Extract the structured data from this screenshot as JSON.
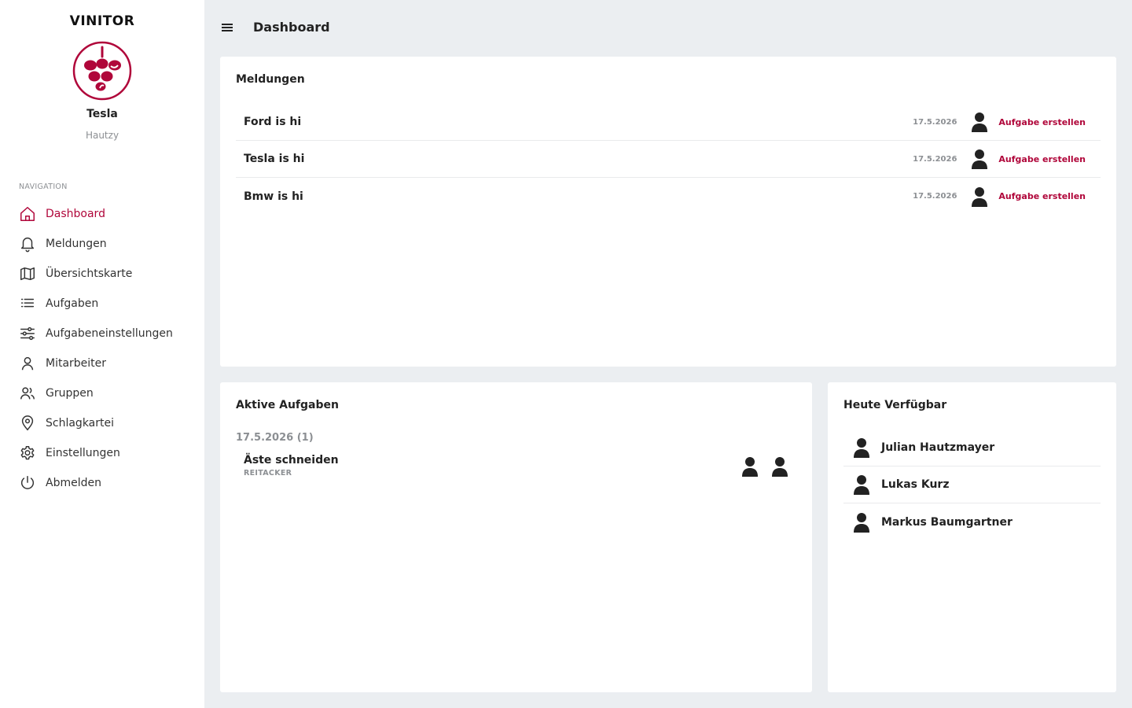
{
  "app": {
    "brand": "VINITOR"
  },
  "user": {
    "name": "Tesla",
    "subtitle": "Hautzy"
  },
  "sidebar": {
    "heading": "NAVIGATION",
    "items": [
      {
        "label": "Dashboard",
        "icon": "home-icon",
        "active": true
      },
      {
        "label": "Meldungen",
        "icon": "bell-icon"
      },
      {
        "label": "Übersichtskarte",
        "icon": "map-icon"
      },
      {
        "label": "Aufgaben",
        "icon": "list-icon"
      },
      {
        "label": "Aufgabeneinstellungen",
        "icon": "sliders-icon"
      },
      {
        "label": "Mitarbeiter",
        "icon": "user-icon"
      },
      {
        "label": "Gruppen",
        "icon": "users-icon"
      },
      {
        "label": "Schlagkartei",
        "icon": "map-pin-icon"
      },
      {
        "label": "Einstellungen",
        "icon": "gear-icon"
      },
      {
        "label": "Abmelden",
        "icon": "power-icon"
      }
    ]
  },
  "header": {
    "title": "Dashboard"
  },
  "messages": {
    "title": "Meldungen",
    "items": [
      {
        "text": "Ford is hi",
        "date": "17.5.2026",
        "action": "Aufgabe erstellen"
      },
      {
        "text": "Tesla is hi",
        "date": "17.5.2026",
        "action": "Aufgabe erstellen"
      },
      {
        "text": "Bmw is hi",
        "date": "17.5.2026",
        "action": "Aufgabe erstellen"
      }
    ]
  },
  "tasks": {
    "title": "Aktive Aufgaben",
    "date_group": "17.5.2026 (1)",
    "items": [
      {
        "name": "Äste schneiden",
        "field": "REITACKER",
        "assignees": 2
      }
    ]
  },
  "available": {
    "title": "Heute Verfügbar",
    "people": [
      "Julian Hautzmayer",
      "Lukas Kurz",
      "Markus Baumgartner"
    ]
  },
  "colors": {
    "accent": "#b0063a",
    "background": "#ebeef1",
    "muted": "#8c8f93"
  }
}
